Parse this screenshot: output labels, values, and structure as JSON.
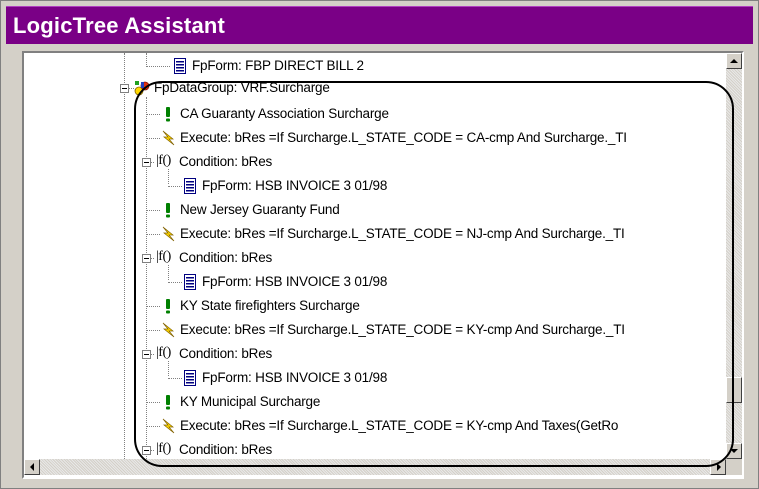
{
  "window": {
    "title": "LogicTree Assistant",
    "title_bar_color": "#7a0086"
  },
  "tree": {
    "items": [
      {
        "label": "FpForm: FBP DIRECT BILL 2",
        "icon": "form-icon"
      },
      {
        "label": "FpDataGroup: VRF.Surcharge",
        "icon": "datagroup-icon"
      },
      {
        "label": "CA Guaranty Association Surcharge",
        "icon": "exclamation-icon"
      },
      {
        "label": "Execute: bRes =If Surcharge.L_STATE_CODE = CA-cmp And Surcharge._TI",
        "icon": "execute-icon"
      },
      {
        "label": "Condition: bRes",
        "icon": "condition-icon",
        "glyph": "|f()"
      },
      {
        "label": "FpForm: HSB INVOICE 3 01/98",
        "icon": "form-icon"
      },
      {
        "label": "New Jersey Guaranty Fund",
        "icon": "exclamation-icon"
      },
      {
        "label": "Execute: bRes =If Surcharge.L_STATE_CODE = NJ-cmp And Surcharge._TI",
        "icon": "execute-icon"
      },
      {
        "label": "Condition: bRes",
        "icon": "condition-icon",
        "glyph": "|f()"
      },
      {
        "label": "FpForm: HSB INVOICE 3 01/98",
        "icon": "form-icon"
      },
      {
        "label": "KY State firefighters Surcharge",
        "icon": "exclamation-icon"
      },
      {
        "label": "Execute: bRes =If Surcharge.L_STATE_CODE = KY-cmp And Surcharge._TI",
        "icon": "execute-icon"
      },
      {
        "label": "Condition: bRes",
        "icon": "condition-icon",
        "glyph": "|f()"
      },
      {
        "label": "FpForm: HSB INVOICE 3 01/98",
        "icon": "form-icon"
      },
      {
        "label": "KY Municipal Surcharge",
        "icon": "exclamation-icon"
      },
      {
        "label": "Execute: bRes =If Surcharge.L_STATE_CODE = KY-cmp  And Taxes(GetRo",
        "icon": "execute-icon"
      },
      {
        "label": "Condition: bRes",
        "icon": "condition-icon",
        "glyph": "|f()"
      }
    ]
  },
  "scrollbars": {
    "vertical_position": 0.93,
    "horizontal_position": 0.0
  },
  "colors": {
    "exclamation": "#008000",
    "form_icon": "#000080",
    "execute": "#ffd800"
  }
}
